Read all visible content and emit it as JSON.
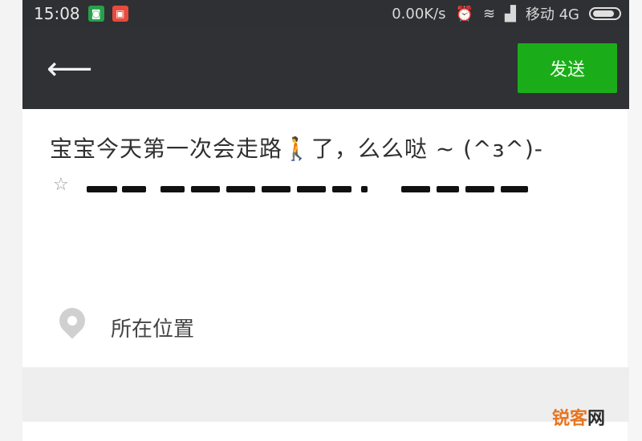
{
  "status_bar": {
    "time": "15:08",
    "speed": "0.00K/s",
    "carrier": "移动 4G"
  },
  "header": {
    "send_label": "发送"
  },
  "post": {
    "text": "宝宝今天第一次会走路🚶了，么么哒 ~ (^з^)-",
    "star": "☆"
  },
  "location": {
    "label": "所在位置"
  },
  "watermark": {
    "part1": "锐客",
    "part2": "网"
  },
  "colors": {
    "header_bg": "#303134",
    "send_button": "#1aad19"
  }
}
